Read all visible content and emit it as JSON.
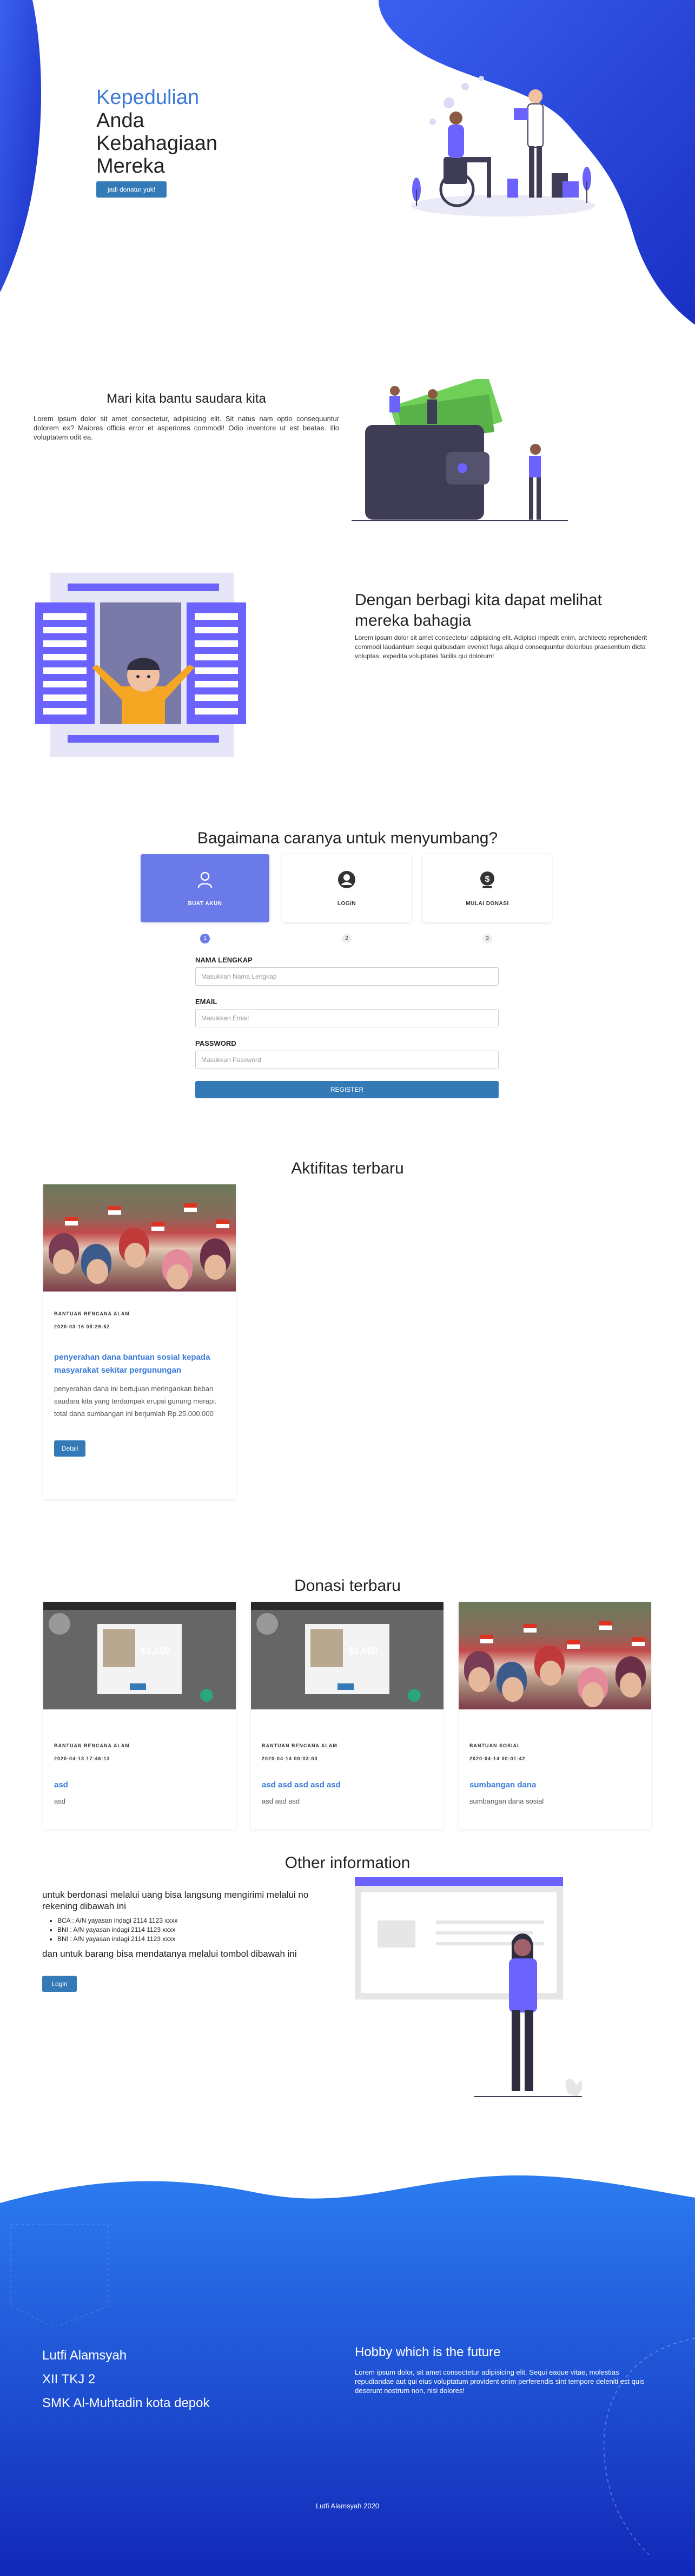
{
  "hero": {
    "title_line1": "Kepedulian",
    "title_line2": "Anda",
    "title_line3": "Kebahagiaan",
    "title_line4": "Mereka",
    "cta_label": "jadi donatur yuk!"
  },
  "intro": {
    "title": "Mari kita bantu saudara kita",
    "text": "Lorem ipsum dolor sit amet consectetur, adipisicing elit. Sit natus nam optio consequuntur dolorem ex? Maiores officia error et asperiores commodi! Odio inventore ut est beatae. Illo voluptatem odit ea."
  },
  "mission": {
    "title": "Dengan berbagi kita dapat melihat mereka bahagia",
    "text": "Lorem ipsum dolor sit amet consectetur adipisicing elit. Adipisci impedit enim, architecto reprehenderit commodi laudantium sequi quibusdam eveniet fuga aliquid consequuntur doloribus praesentium dicta voluptas, expedita voluptates facilis qui dolorum!"
  },
  "howto": {
    "title": "Bagaimana caranya untuk menyumbang?",
    "steps": [
      {
        "label": "BUAT AKUN",
        "number": "1",
        "icon": "user-icon"
      },
      {
        "label": "LOGIN",
        "number": "2",
        "icon": "account-circle-icon"
      },
      {
        "label": "MULAI DONASI",
        "number": "3",
        "icon": "dollar-coin-icon"
      }
    ],
    "active_step": 1,
    "form": {
      "name_label": "NAMA LENGKAP",
      "name_placeholder": "Masukkan Nama Lengkap",
      "email_label": "EMAIL",
      "email_placeholder": "Masukkan Email",
      "password_label": "PASSWORD",
      "password_placeholder": "Masukkan Password",
      "register_label": "REGISTER"
    }
  },
  "activities": {
    "title": "Aktifitas terbaru",
    "items": [
      {
        "category": "BANTUAN BENCANA ALAM",
        "date": "2020-03-16 08:29:52",
        "title": "penyerahan dana bantuan sosial kepada masyarakat sekitar pergunungan",
        "description": "penyerahan dana ini bertujuan meringankan beban saudara kita yang terdampak erupsi gunung merapi. total dana sumbangan ini berjumlah Rp.25.000.000",
        "button": "Detail"
      }
    ]
  },
  "donations": {
    "title": "Donasi terbaru",
    "items": [
      {
        "category": "BANTUAN BENCANA ALAM",
        "date": "2020-04-13 17:46:13",
        "title": "asd",
        "description": "asd"
      },
      {
        "category": "BANTUAN BENCANA ALAM",
        "date": "2020-04-14 00:03:03",
        "title": "asd asd asd asd asd",
        "description": "asd asd asd"
      },
      {
        "category": "BANTUAN SOSIAL",
        "date": "2020-04-14 00:01:42",
        "title": "sumbangan dana",
        "description": "sumbangan dana sosial"
      }
    ],
    "screen_amount": "$1,000"
  },
  "other_info": {
    "title": "Other information",
    "intro": "untuk berdonasi melalui uang bisa langsung mengirimi melalui no rekening dibawah ini",
    "accounts": [
      "BCA : A/N yayasan indagi 2114 1123 xxxx",
      "BNI : A/N yayasan indagi 2114 1123 xxxx",
      "BNI : A/N yayasan indagi 2114 1123 xxxx"
    ],
    "goods_text": "dan untuk barang bisa mendatanya melalui tombol dibawah ini",
    "button": "Login"
  },
  "footer": {
    "name": "Lutfi Alamsyah",
    "class": "XII TKJ 2",
    "school": "SMK Al-Muhtadin kota depok",
    "hobby_title": "Hobby which is the future",
    "hobby_text": "Lorem ipsum dolor, sit amet consectetur adipisicing elit. Sequi eaque vitae, molestias repudiandae aut qui eius voluptatum provident enim perferendis sint tempore deleniti est quis deserunt nostrum non, nisi dolores!",
    "copyright": "Lutfi Alamsyah 2020"
  },
  "colors": {
    "accent_blue": "#3b7ad9",
    "button_blue": "#337ab7",
    "step_active": "#6a7ae8",
    "illustration_purple": "#6c63ff",
    "footer_blue": "#1f3fd0"
  }
}
